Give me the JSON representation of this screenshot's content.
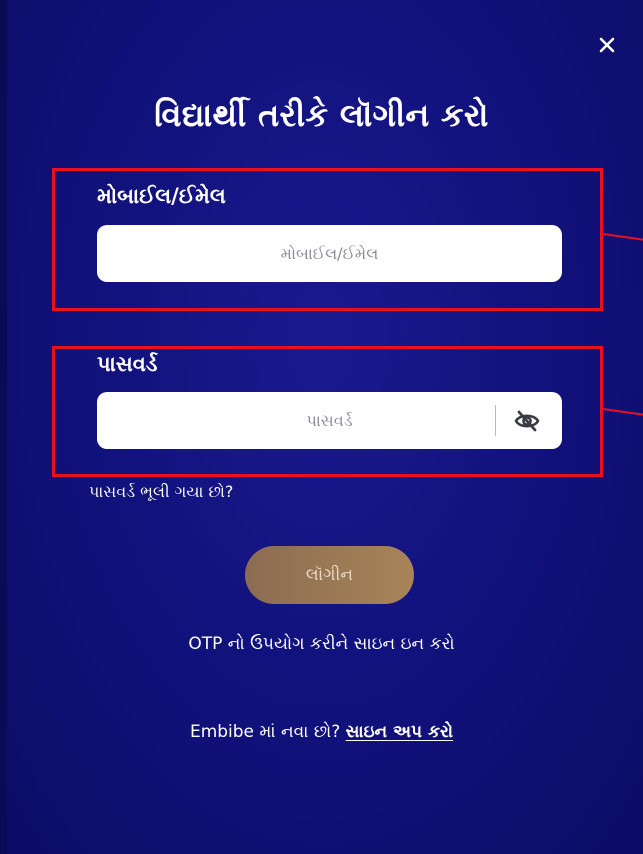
{
  "dialog": {
    "title": "વિદ્યાર્થી તરીકે લૉગીન કરો",
    "close_icon": "close-icon"
  },
  "mobile_email": {
    "label": "મોબાઈલ/ઈમેલ",
    "placeholder": "મોબાઈલ/ઈમેલ",
    "value": ""
  },
  "password": {
    "label": "પાસવર્ડ",
    "placeholder": "પાસવર્ડ",
    "value": "",
    "toggle_icon": "eye-off-icon"
  },
  "forgot_password": "પાસવર્ડ ભૂલી ગયા છો?",
  "login_button": "લૉગીન",
  "otp_link": "OTP નો ઉપયોગ કરીને સાઇન ઇન કરો",
  "signup": {
    "prompt": "Embibe માં નવા છો? ",
    "link": "સાઇન અપ કરો"
  },
  "colors": {
    "background": "#12127e",
    "highlight": "#e8121f",
    "login_button": "#a88458"
  }
}
